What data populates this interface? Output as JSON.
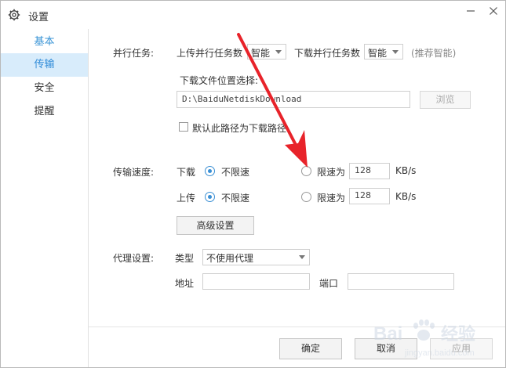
{
  "window": {
    "title": "设置"
  },
  "sidebar": {
    "items": [
      {
        "label": "基本"
      },
      {
        "label": "传输"
      },
      {
        "label": "安全"
      },
      {
        "label": "提醒"
      }
    ]
  },
  "parallel": {
    "label": "并行任务:",
    "upload_label": "上传并行任务数",
    "upload_value": "智能",
    "download_label": "下载并行任务数",
    "download_value": "智能",
    "hint": "(推荐智能)"
  },
  "download_location": {
    "label": "下载文件位置选择:",
    "path": "D:\\BaiduNetdiskDownload",
    "browse_label": "浏览",
    "default_checkbox_label": "默认此路径为下载路径"
  },
  "speed": {
    "label": "传输速度:",
    "download_label": "下载",
    "upload_label": "上传",
    "unlimited_label": "不限速",
    "limit_label": "限速为",
    "download_limit_value": "128",
    "upload_limit_value": "128",
    "unit": "KB/s",
    "advanced_button": "高级设置"
  },
  "proxy": {
    "label": "代理设置:",
    "type_label": "类型",
    "type_value": "不使用代理",
    "address_label": "地址",
    "port_label": "端口"
  },
  "footer": {
    "ok": "确定",
    "cancel": "取消",
    "apply": "应用"
  },
  "colors": {
    "accent": "#3a8fd4",
    "sidebar_active_bg": "#d8ecfb",
    "annotation_arrow": "#e8232a"
  }
}
